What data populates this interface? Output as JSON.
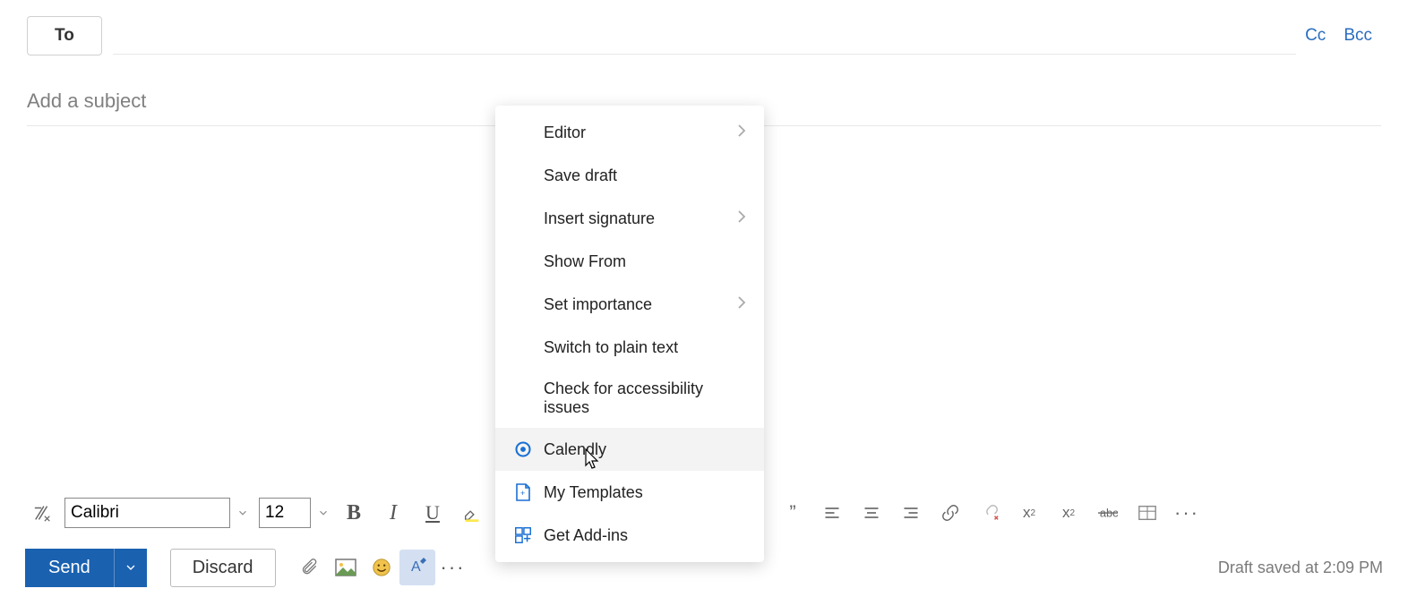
{
  "header": {
    "to_label": "To",
    "cc_label": "Cc",
    "bcc_label": "Bcc"
  },
  "subject": {
    "placeholder": "Add a subject",
    "value": ""
  },
  "dropdown": {
    "items": [
      {
        "label": "Editor",
        "submenu": true,
        "icon": null
      },
      {
        "label": "Save draft",
        "submenu": false,
        "icon": null
      },
      {
        "label": "Insert signature",
        "submenu": true,
        "icon": null
      },
      {
        "label": "Show From",
        "submenu": false,
        "icon": null
      },
      {
        "label": "Set importance",
        "submenu": true,
        "icon": null
      },
      {
        "label": "Switch to plain text",
        "submenu": false,
        "icon": null
      },
      {
        "label": "Check for accessibility issues",
        "submenu": false,
        "icon": null
      },
      {
        "label": "Calendly",
        "submenu": false,
        "icon": "calendly-icon",
        "hovered": true
      },
      {
        "label": "My Templates",
        "submenu": false,
        "icon": "templates-icon"
      },
      {
        "label": "Get Add-ins",
        "submenu": false,
        "icon": "addins-icon"
      }
    ]
  },
  "toolbar": {
    "font_name": "Calibri",
    "font_size": "12",
    "icons": {
      "clear_format": "clear-formatting-icon",
      "bold": "B",
      "italic": "I",
      "underline": "U",
      "highlight": "highlight-icon",
      "quote": "”",
      "align_left": "align-left-icon",
      "align_center": "align-center-icon",
      "align_right": "align-right-icon",
      "link": "link-icon",
      "unlink": "unlink-icon",
      "superscript": "superscript-icon",
      "subscript": "subscript-icon",
      "strike": "strikethrough-icon",
      "table": "table-icon",
      "more": "more-icon"
    }
  },
  "bottom": {
    "send_label": "Send",
    "discard_label": "Discard",
    "status": "Draft saved at 2:09 PM",
    "icons": {
      "attach": "paperclip-icon",
      "image": "image-icon",
      "emoji": "emoji-icon",
      "format": "format-icon",
      "more": "more-icon"
    }
  }
}
